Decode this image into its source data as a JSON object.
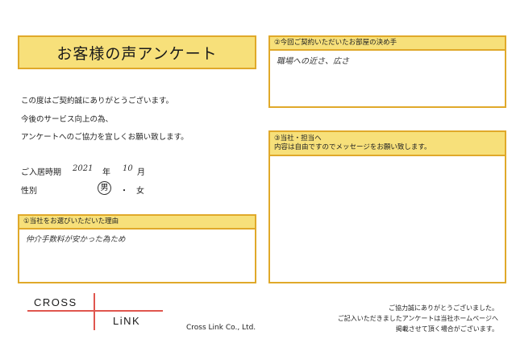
{
  "title": "お客様の声アンケート",
  "intro": [
    "この度はご契約誠にありがとうございます。",
    "今後のサービス向上の為、",
    "アンケートへのご協力を宜しくお願い致します。"
  ],
  "move_in": {
    "label": "ご入居時期",
    "year_value": "2021",
    "year_unit": "年",
    "month_value": "10",
    "month_unit": "月"
  },
  "gender": {
    "label": "性別",
    "male": "男",
    "separator": "・",
    "female": "女",
    "selected": "男"
  },
  "q1": {
    "header": "①当社をお選びいただいた理由",
    "answer": "仲介手数料が安かった為ため"
  },
  "q2": {
    "header": "②今回ご契約いただいたお部屋の決め手",
    "answer": "職場への近さ、広さ"
  },
  "q3": {
    "header_line1": "③当社・担当へ",
    "header_line2": "内容は自由ですのでメッセージをお願い致します。",
    "answer": ""
  },
  "logo": {
    "top": "CROSS",
    "bottom": "LiNK"
  },
  "company": "Cross Link Co., Ltd.",
  "footer": [
    "ご協力誠にありがとうございました。",
    "ご記入いただきましたアンケートは当社ホームページへ",
    "掲載させて頂く場合がございます。"
  ],
  "colors": {
    "accent_fill": "#f7e07a",
    "accent_border": "#e0a92a",
    "logo_red": "#e0564e"
  }
}
